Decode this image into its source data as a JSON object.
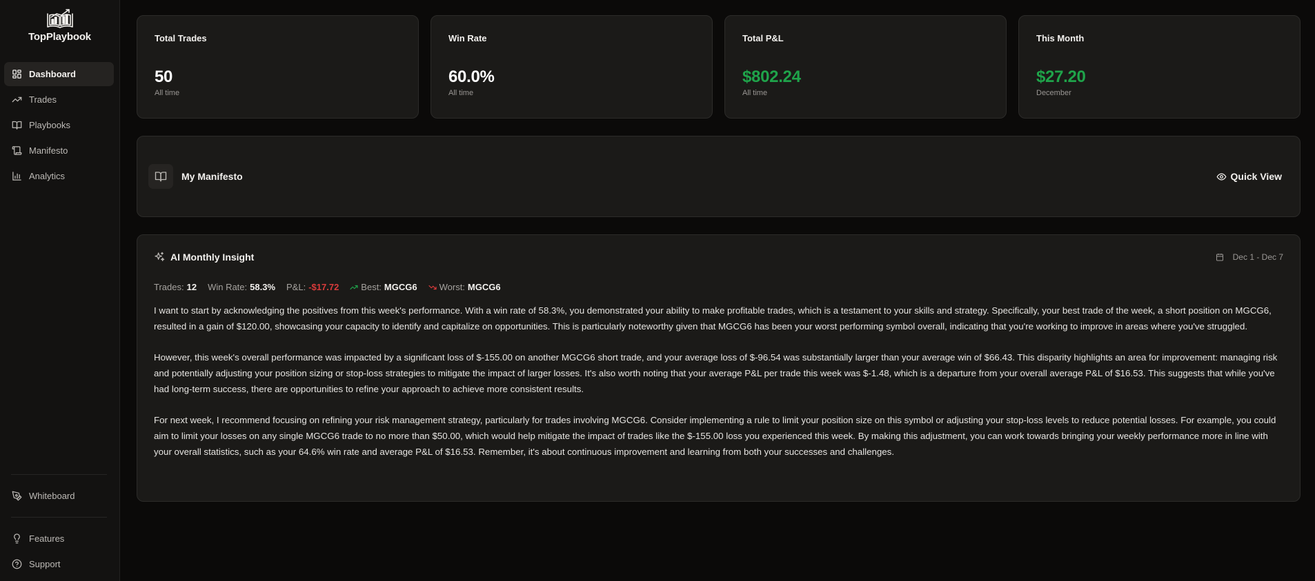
{
  "app": {
    "name": "TopPlaybook"
  },
  "colors": {
    "accent_green": "#1fa34a",
    "loss_red": "#d93b3b",
    "background": "#0b0a09",
    "card": "#1b1a18"
  },
  "sidebar": {
    "items": [
      {
        "label": "Dashboard",
        "icon": "dashboard-icon",
        "active": true
      },
      {
        "label": "Trades",
        "icon": "trending-up-icon"
      },
      {
        "label": "Playbooks",
        "icon": "book-open-icon"
      },
      {
        "label": "Manifesto",
        "icon": "scroll-icon"
      },
      {
        "label": "Analytics",
        "icon": "bar-chart-icon"
      }
    ],
    "bottom": [
      {
        "label": "Whiteboard",
        "icon": "pen-tool-icon"
      },
      {
        "label": "Features",
        "icon": "lightbulb-icon"
      },
      {
        "label": "Support",
        "icon": "help-circle-icon"
      }
    ]
  },
  "stats": [
    {
      "title": "Total Trades",
      "value": "50",
      "sub": "All time"
    },
    {
      "title": "Win Rate",
      "value": "60.0%",
      "sub": "All time"
    },
    {
      "title": "Total P&L",
      "value": "$802.24",
      "sub": "All time"
    },
    {
      "title": "This Month",
      "value": "$27.20",
      "sub": "December"
    }
  ],
  "manifesto": {
    "title": "My Manifesto",
    "quick_view": "Quick View"
  },
  "insight": {
    "title": "AI Monthly Insight",
    "date_range": "Dec 1 - Dec 7",
    "metrics": {
      "trades_label": "Trades:",
      "trades": "12",
      "win_rate_label": "Win Rate:",
      "win_rate": "58.3%",
      "pnl_label": "P&L:",
      "pnl": "-$17.72",
      "best_label": "Best:",
      "best": "MGCG6",
      "worst_label": "Worst:",
      "worst": "MGCG6"
    },
    "paragraphs": [
      "I want to start by acknowledging the positives from this week's performance. With a win rate of 58.3%, you demonstrated your ability to make profitable trades, which is a testament to your skills and strategy. Specifically, your best trade of the week, a short position on MGCG6, resulted in a gain of $120.00, showcasing your capacity to identify and capitalize on opportunities. This is particularly noteworthy given that MGCG6 has been your worst performing symbol overall, indicating that you're working to improve in areas where you've struggled.",
      "However, this week's overall performance was impacted by a significant loss of $-155.00 on another MGCG6 short trade, and your average loss of $-96.54 was substantially larger than your average win of $66.43. This disparity highlights an area for improvement: managing risk and potentially adjusting your position sizing or stop-loss strategies to mitigate the impact of larger losses. It's also worth noting that your average P&L per trade this week was $-1.48, which is a departure from your overall average P&L of $16.53. This suggests that while you've had long-term success, there are opportunities to refine your approach to achieve more consistent results.",
      "For next week, I recommend focusing on refining your risk management strategy, particularly for trades involving MGCG6. Consider implementing a rule to limit your position size on this symbol or adjusting your stop-loss levels to reduce potential losses. For example, you could aim to limit your losses on any single MGCG6 trade to no more than $50.00, which would help mitigate the impact of trades like the $-155.00 loss you experienced this week. By making this adjustment, you can work towards bringing your weekly performance more in line with your overall statistics, such as your 64.6% win rate and average P&L of $16.53. Remember, it's about continuous improvement and learning from both your successes and challenges."
    ]
  }
}
